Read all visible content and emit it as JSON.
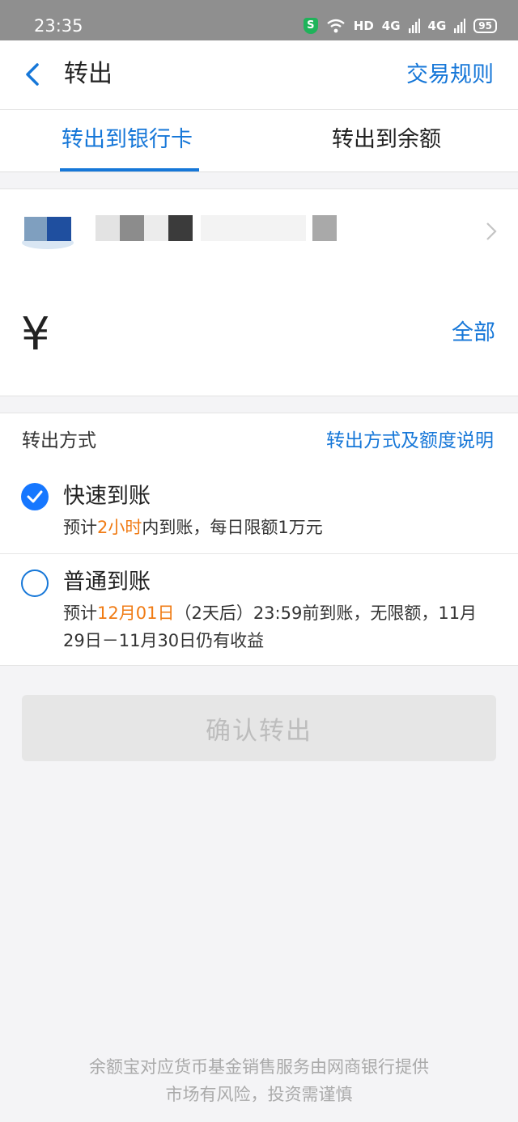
{
  "status_bar": {
    "time": "23:35",
    "hd_label": "HD",
    "network_1": "4G",
    "network_2": "4G",
    "battery": "95"
  },
  "nav": {
    "title": "转出",
    "right_link": "交易规则"
  },
  "tabs": [
    {
      "label": "转出到银行卡",
      "active": true
    },
    {
      "label": "转出到余额",
      "active": false
    }
  ],
  "amount": {
    "currency_symbol": "¥",
    "all_label": "全部"
  },
  "method": {
    "label": "转出方式",
    "info_link": "转出方式及额度说明",
    "options": [
      {
        "title": "快速到账",
        "selected": true,
        "desc_prefix": "预计",
        "desc_highlight": "2小时",
        "desc_suffix": "内到账，每日限额1万元"
      },
      {
        "title": "普通到账",
        "selected": false,
        "desc_prefix": "预计",
        "desc_highlight": "12月01日",
        "desc_suffix": "（2天后）23:59前到账，无限额，11月29日－11月30日仍有收益"
      }
    ]
  },
  "confirm_button": "确认转出",
  "footer": {
    "line1": "余额宝对应货币基金销售服务由网商银行提供",
    "line2": "市场有风险，投资需谨慎"
  },
  "colors": {
    "accent": "#1677d8",
    "highlight": "#f07b14",
    "disabled_bg": "#e6e6e6"
  }
}
